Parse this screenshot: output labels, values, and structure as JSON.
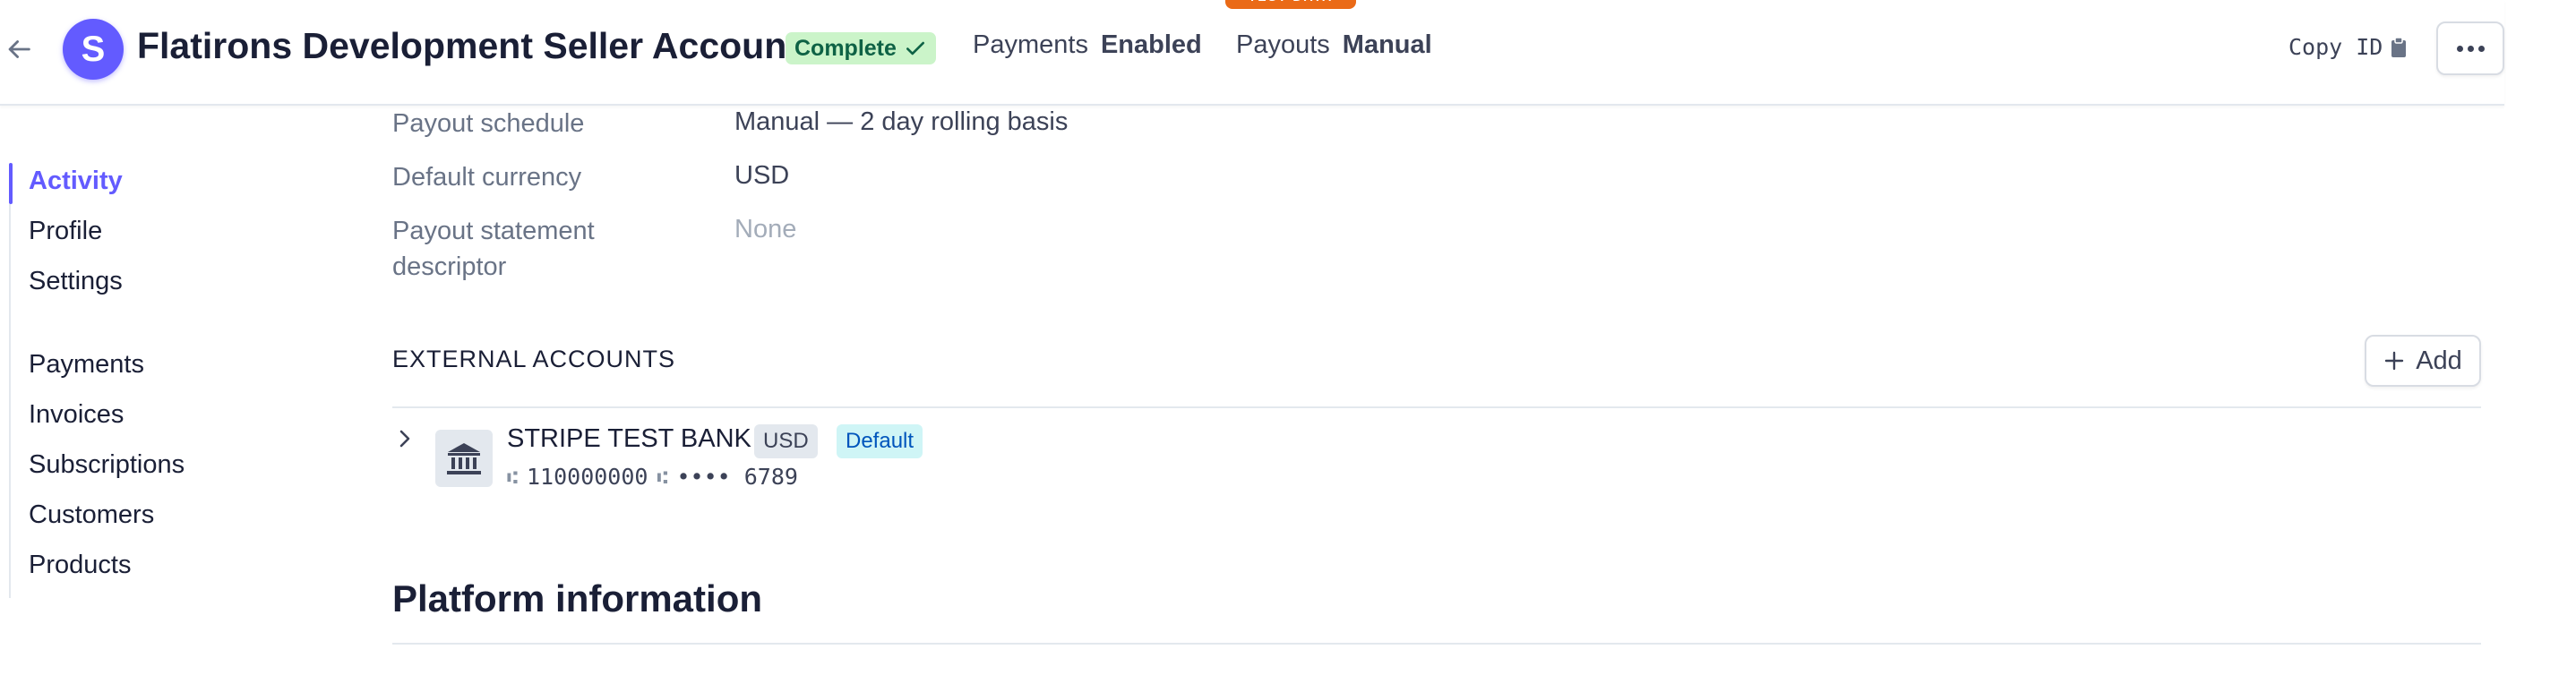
{
  "test_badge": "TEST DATA",
  "header": {
    "avatar_letter": "S",
    "title": "Flatirons Development Seller Account",
    "status": "Complete",
    "payments_label": "Payments",
    "payments_value": "Enabled",
    "payouts_label": "Payouts",
    "payouts_value": "Manual",
    "copy_id": "Copy ID"
  },
  "sidebar": {
    "items": [
      {
        "label": "Activity",
        "active": true
      },
      {
        "label": "Profile"
      },
      {
        "label": "Settings"
      },
      {
        "label": "Payments"
      },
      {
        "label": "Invoices"
      },
      {
        "label": "Subscriptions"
      },
      {
        "label": "Customers"
      },
      {
        "label": "Products"
      }
    ]
  },
  "details": [
    {
      "label": "Payout schedule",
      "value": "Manual — 2 day rolling basis"
    },
    {
      "label": "Default currency",
      "value": "USD"
    },
    {
      "label": "Payout statement descriptor",
      "value": "None"
    }
  ],
  "external_accounts": {
    "heading": "EXTERNAL ACCOUNTS",
    "add_label": "Add",
    "bank": {
      "name": "STRIPE TEST BANK",
      "currency": "USD",
      "default_tag": "Default",
      "routing": "110000000",
      "account": "•••• 6789"
    }
  },
  "platform": {
    "title": "Platform information"
  },
  "colors": {
    "accent": "#635bff",
    "test_badge": "#ea6a17",
    "complete_bg": "#cbf4c9"
  }
}
